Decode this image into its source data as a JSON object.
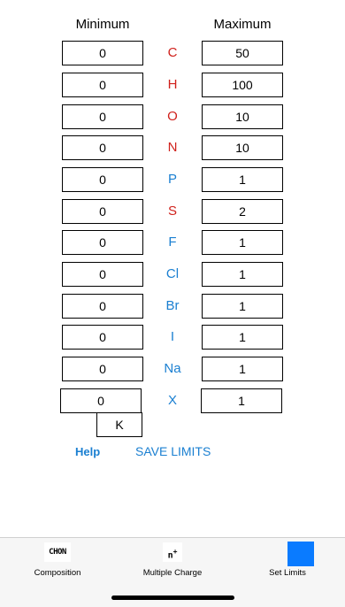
{
  "headers": {
    "minimum": "Minimum",
    "maximum": "Maximum"
  },
  "colors": {
    "accent": "#1a7fd1",
    "red_element": "#d0211c",
    "active_tab": "#0a7bff"
  },
  "rows": [
    {
      "min": "0",
      "element": "C",
      "max": "50",
      "color": "red"
    },
    {
      "min": "0",
      "element": "H",
      "max": "100",
      "color": "red"
    },
    {
      "min": "0",
      "element": "O",
      "max": "10",
      "color": "red"
    },
    {
      "min": "0",
      "element": "N",
      "max": "10",
      "color": "red"
    },
    {
      "min": "0",
      "element": "P",
      "max": "1",
      "color": "blue"
    },
    {
      "min": "0",
      "element": "S",
      "max": "2",
      "color": "red"
    },
    {
      "min": "0",
      "element": "F",
      "max": "1",
      "color": "blue"
    },
    {
      "min": "0",
      "element": "Cl",
      "max": "1",
      "color": "blue"
    },
    {
      "min": "0",
      "element": "Br",
      "max": "1",
      "color": "blue"
    },
    {
      "min": "0",
      "element": "I",
      "max": "1",
      "color": "blue"
    },
    {
      "min": "0",
      "element": "Na",
      "max": "1",
      "color": "blue"
    },
    {
      "min": "0",
      "element": "X",
      "max": "1",
      "color": "blue"
    }
  ],
  "x_symbol_value": "K",
  "actions": {
    "help": "Help",
    "save": "SAVE LIMITS"
  },
  "tabs": [
    {
      "label": "Composition",
      "icon": "chon-icon",
      "icon_text": "CHON"
    },
    {
      "label": "Multiple Charge",
      "icon": "charge-icon",
      "icon_text": "n",
      "icon_sup": "+"
    },
    {
      "label": "Set Limits",
      "icon": "set-limits-icon",
      "active": true
    }
  ]
}
